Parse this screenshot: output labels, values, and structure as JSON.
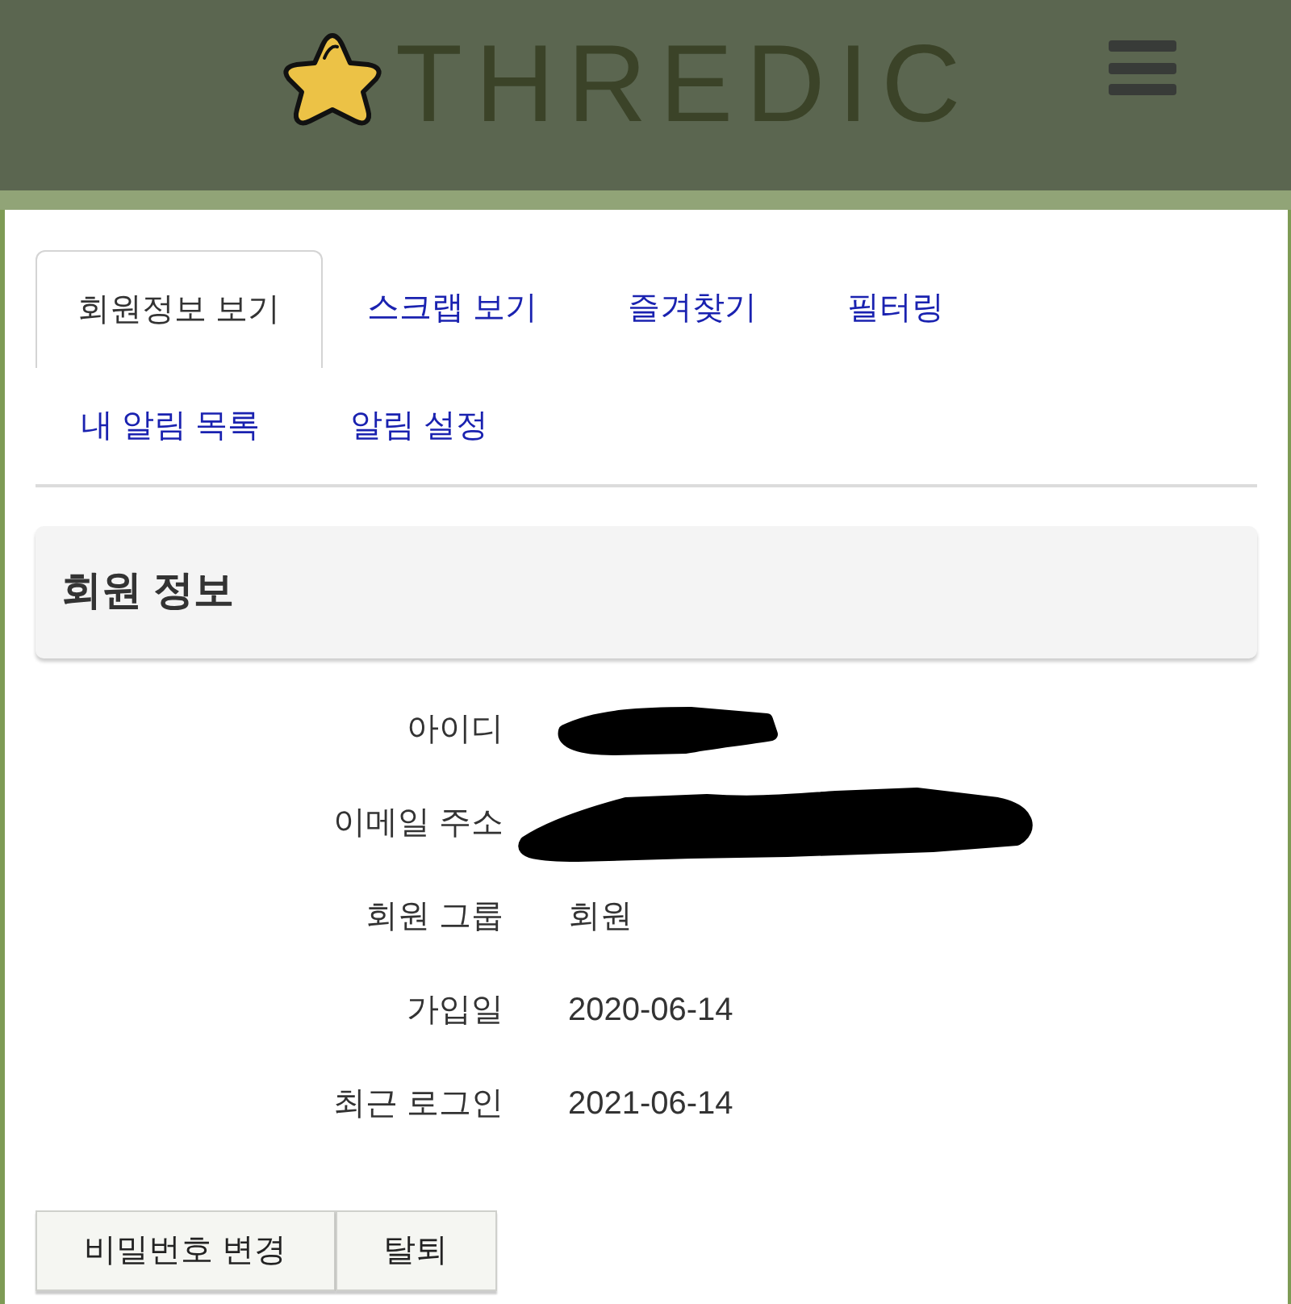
{
  "header": {
    "logo_text": "THREDIC"
  },
  "tabs": [
    {
      "label": "회원정보 보기",
      "selected": true
    },
    {
      "label": "스크랩 보기",
      "selected": false
    },
    {
      "label": "즐겨찾기",
      "selected": false
    },
    {
      "label": "필터링",
      "selected": false
    },
    {
      "label": "내 알림 목록",
      "selected": false
    },
    {
      "label": "알림 설정",
      "selected": false
    }
  ],
  "panel": {
    "title": "회원 정보"
  },
  "fields": [
    {
      "label": "아이디",
      "kind": "redacted"
    },
    {
      "label": "이메일 주소",
      "kind": "redacted"
    },
    {
      "label": "회원 그룹",
      "kind": "text",
      "value": "회원"
    },
    {
      "label": "가입일",
      "kind": "text",
      "value": "2020-06-14"
    },
    {
      "label": "최근 로그인",
      "kind": "text",
      "value": "2021-06-14"
    }
  ],
  "buttons": [
    "비밀번호 변경",
    "탈퇴"
  ]
}
